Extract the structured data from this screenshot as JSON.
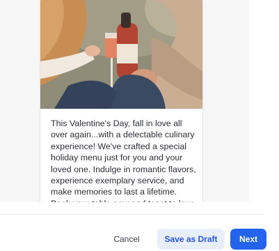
{
  "post": {
    "body": "This Valentine's Day, fall in love all\nover again...with a delectable culinary\nexperience! We've crafted a special\nholiday menu just for you and your\nloved one. Indulge in romantic flavors,\nexperience exemplary service, and\nmake memories to last a lifetime.\nBook your table now and toast to love"
  },
  "footer": {
    "cancel_label": "Cancel",
    "save_draft_label": "Save as Draft",
    "next_label": "Next"
  }
}
